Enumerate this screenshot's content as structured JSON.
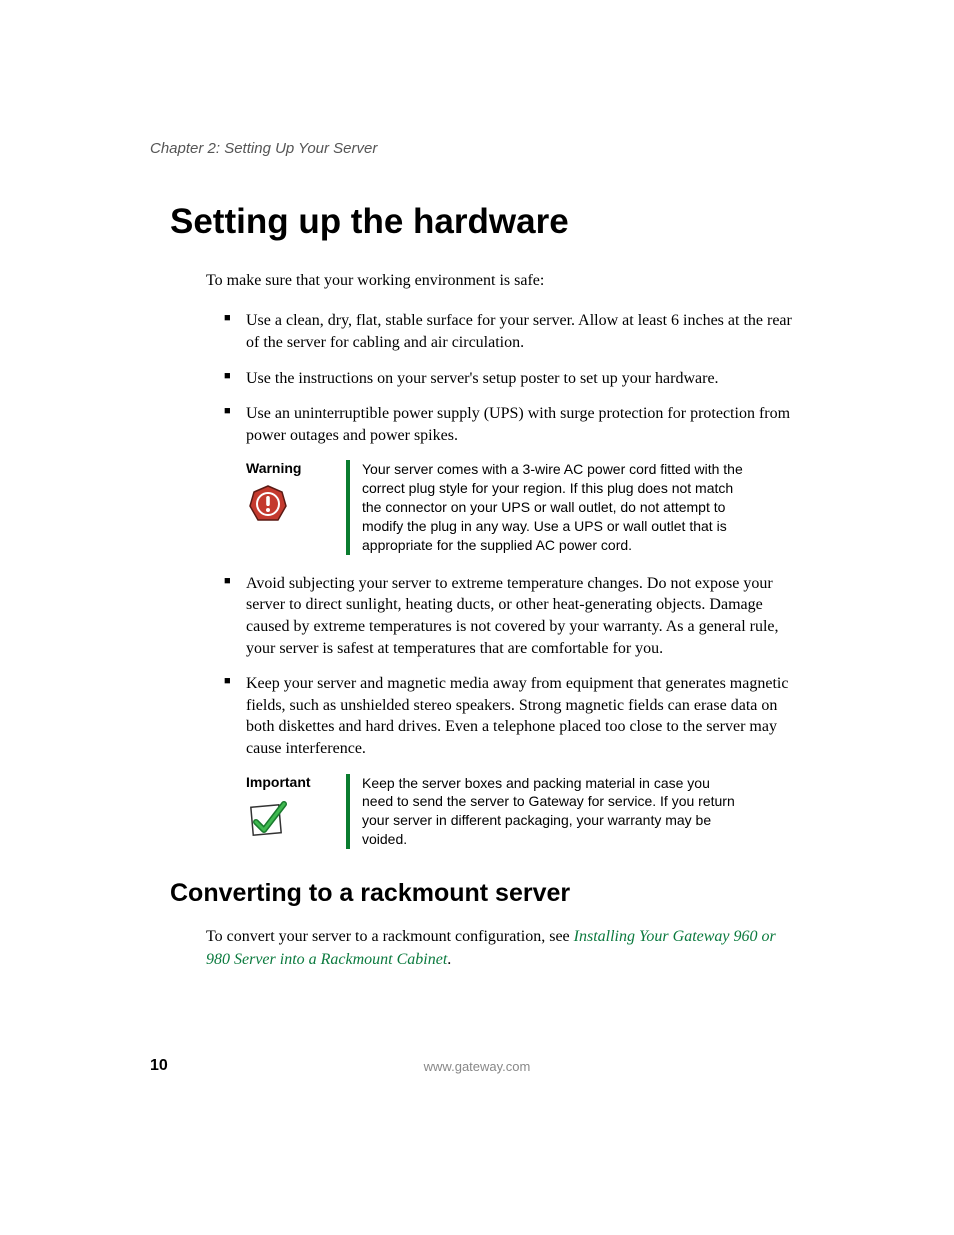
{
  "chapter_header": "Chapter 2: Setting Up Your Server",
  "h1": "Setting up the hardware",
  "intro": "To make sure that your working environment is safe:",
  "bullets": [
    "Use a clean, dry, flat, stable surface for your server. Allow at least 6 inches at the rear of the server for cabling and air circulation.",
    "Use the instructions on your server's setup poster to set up your hardware.",
    "Use an uninterruptible power supply (UPS) with surge protection for protection from power outages and power spikes.",
    "Avoid subjecting your server to extreme temperature changes. Do not expose your server to direct sunlight, heating ducts, or other heat-generating objects. Damage caused by extreme temperatures is not covered by your warranty. As a general rule, your server is safest at temperatures that are comfortable for you.",
    "Keep your server and magnetic media away from equipment that generates magnetic fields, such as unshielded stereo speakers. Strong magnetic fields can erase data on both diskettes and hard drives. Even a telephone placed too close to the server may cause interference."
  ],
  "warning": {
    "label": "Warning",
    "text": "Your server comes with a 3-wire AC power cord fitted with the correct plug style for your region. If this plug does not match the connector on your UPS or wall outlet, do not attempt to modify the plug in any way. Use a UPS or wall outlet that is appropriate for the supplied AC power cord."
  },
  "important": {
    "label": "Important",
    "text": "Keep the server boxes and packing material in case you need to send the server to Gateway for service. If you return your server in different packaging, your warranty may be voided."
  },
  "h2": "Converting to a rackmount server",
  "convert_text_prefix": "To convert your server to a rackmount configuration, see ",
  "convert_link": "Installing Your Gateway 960 or 980 Server into a Rackmount Cabinet",
  "convert_text_suffix": ".",
  "footer": {
    "page": "10",
    "url": "www.gateway.com"
  }
}
